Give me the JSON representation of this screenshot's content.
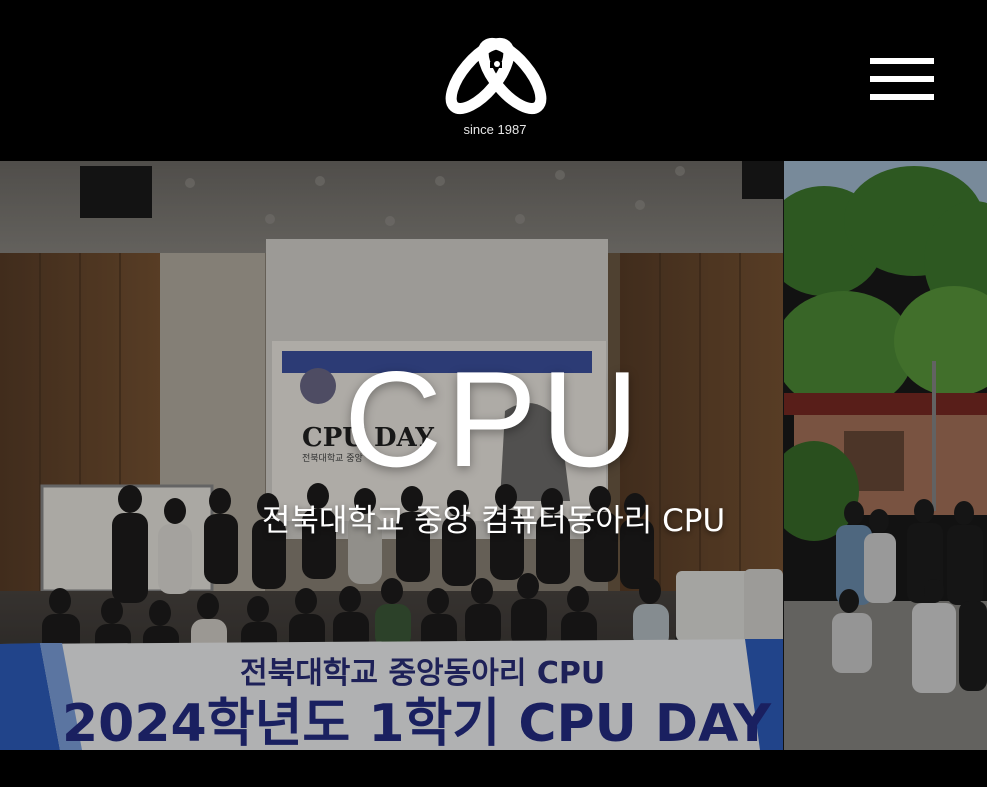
{
  "header": {
    "since_text": "since 1987",
    "logo_icon": "cpu-ribbon-logo-icon",
    "menu_icon": "hamburger-menu-icon"
  },
  "hero": {
    "title": "CPU",
    "subtitle": "전북대학교 중앙 컴퓨터동아리  CPU"
  },
  "slides": {
    "main": {
      "banner_line1": "전북대학교 중앙동아리 CPU",
      "banner_line2": "2024학년도 1학기 CPU DAY",
      "screen_title": "CPU DAY",
      "screen_subtitle": "전북대학교 중앙"
    }
  },
  "colors": {
    "background": "#000000",
    "banner_text": "#242d86",
    "banner_stripe": "#2f5fbf",
    "hero_text": "#ffffff"
  }
}
